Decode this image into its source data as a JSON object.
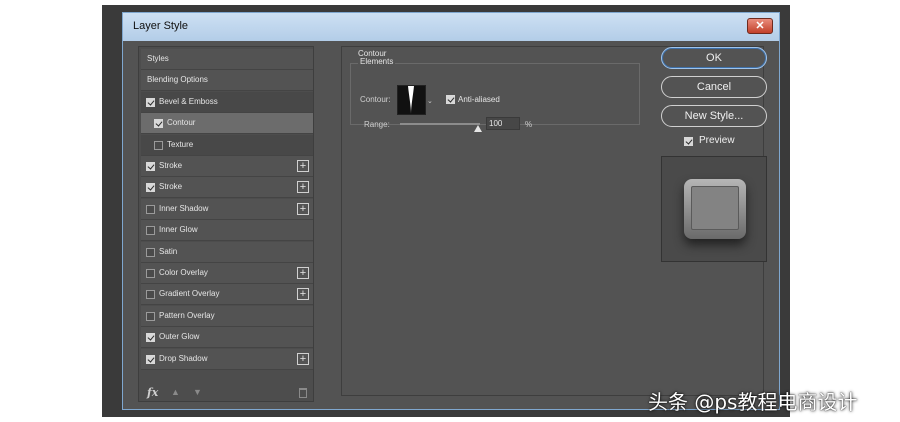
{
  "window": {
    "title": "Layer Style",
    "close_label": "✕"
  },
  "styles_list": [
    {
      "label": "Styles",
      "checkbox": null,
      "plus": false
    },
    {
      "label": "Blending Options",
      "checkbox": null,
      "plus": false
    },
    {
      "label": "Bevel & Emboss",
      "checkbox": true,
      "plus": false
    },
    {
      "label": "Contour",
      "checkbox": true,
      "plus": false,
      "sub": true,
      "selected": true
    },
    {
      "label": "Texture",
      "checkbox": false,
      "plus": false,
      "sub": true
    },
    {
      "label": "Stroke",
      "checkbox": true,
      "plus": true
    },
    {
      "label": "Stroke",
      "checkbox": true,
      "plus": true
    },
    {
      "label": "Inner Shadow",
      "checkbox": false,
      "plus": true
    },
    {
      "label": "Inner Glow",
      "checkbox": false,
      "plus": false
    },
    {
      "label": "Satin",
      "checkbox": false,
      "plus": false
    },
    {
      "label": "Color Overlay",
      "checkbox": false,
      "plus": true
    },
    {
      "label": "Gradient Overlay",
      "checkbox": false,
      "plus": true
    },
    {
      "label": "Pattern Overlay",
      "checkbox": false,
      "plus": false
    },
    {
      "label": "Outer Glow",
      "checkbox": true,
      "plus": false
    },
    {
      "label": "Drop Shadow",
      "checkbox": true,
      "plus": true
    }
  ],
  "bottom_toolbar": {
    "fx_label": "fx",
    "up_icon": "arrow-up-icon",
    "down_icon": "arrow-down-icon",
    "trash_icon": "trash-icon"
  },
  "contour_panel": {
    "group_title": "Contour",
    "elements_title": "Elements",
    "contour_label": "Contour:",
    "anti_aliased_label": "Anti-aliased",
    "anti_aliased": true,
    "range_label": "Range:",
    "range_value": "100",
    "range_unit": "%",
    "range_fraction": 1.0
  },
  "buttons": {
    "ok": "OK",
    "cancel": "Cancel",
    "new_style": "New Style..."
  },
  "preview": {
    "label": "Preview",
    "checked": true
  },
  "watermark": "头条 @ps教程电商设计",
  "colors": {
    "dialog_bg": "#535353",
    "titlebar": "#cde0f3",
    "accent_border": "#9fc4ec"
  }
}
